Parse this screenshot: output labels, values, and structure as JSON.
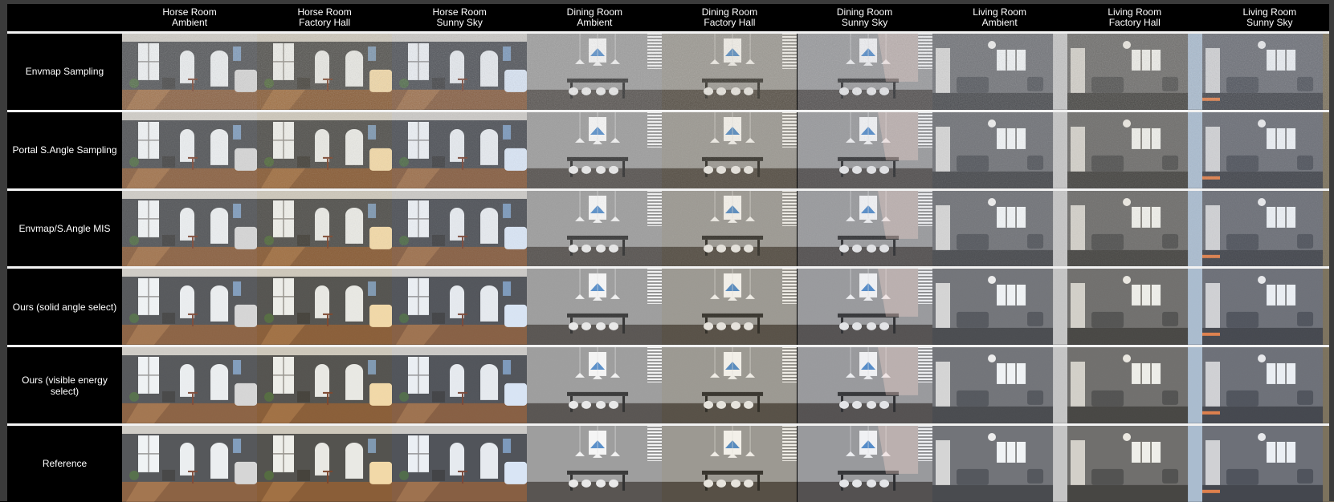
{
  "columns": [
    {
      "scene": "Horse Room",
      "lighting": "Ambient"
    },
    {
      "scene": "Horse Room",
      "lighting": "Factory Hall"
    },
    {
      "scene": "Horse Room",
      "lighting": "Sunny Sky"
    },
    {
      "scene": "Dining Room",
      "lighting": "Ambient"
    },
    {
      "scene": "Dining Room",
      "lighting": "Factory Hall"
    },
    {
      "scene": "Dining Room",
      "lighting": "Sunny Sky"
    },
    {
      "scene": "Living Room",
      "lighting": "Ambient"
    },
    {
      "scene": "Living Room",
      "lighting": "Factory Hall"
    },
    {
      "scene": "Living Room",
      "lighting": "Sunny Sky"
    }
  ],
  "rows": [
    {
      "label": "Envmap Sampling",
      "noise": 0.75
    },
    {
      "label": "Portal S.Angle Sampling",
      "noise": 0.45
    },
    {
      "label": "Envmap/S.Angle MIS",
      "noise": 0.35
    },
    {
      "label": "Ours (solid angle select)",
      "noise": 0.12
    },
    {
      "label": "Ours (visible energy select)",
      "noise": 0.08
    },
    {
      "label": "Reference",
      "noise": 0.0
    }
  ],
  "lighting_tints": {
    "Ambient": "#ffffff",
    "Factory Hall": "#f3d9a8",
    "Sunny Sky": "#d9e6f5"
  }
}
